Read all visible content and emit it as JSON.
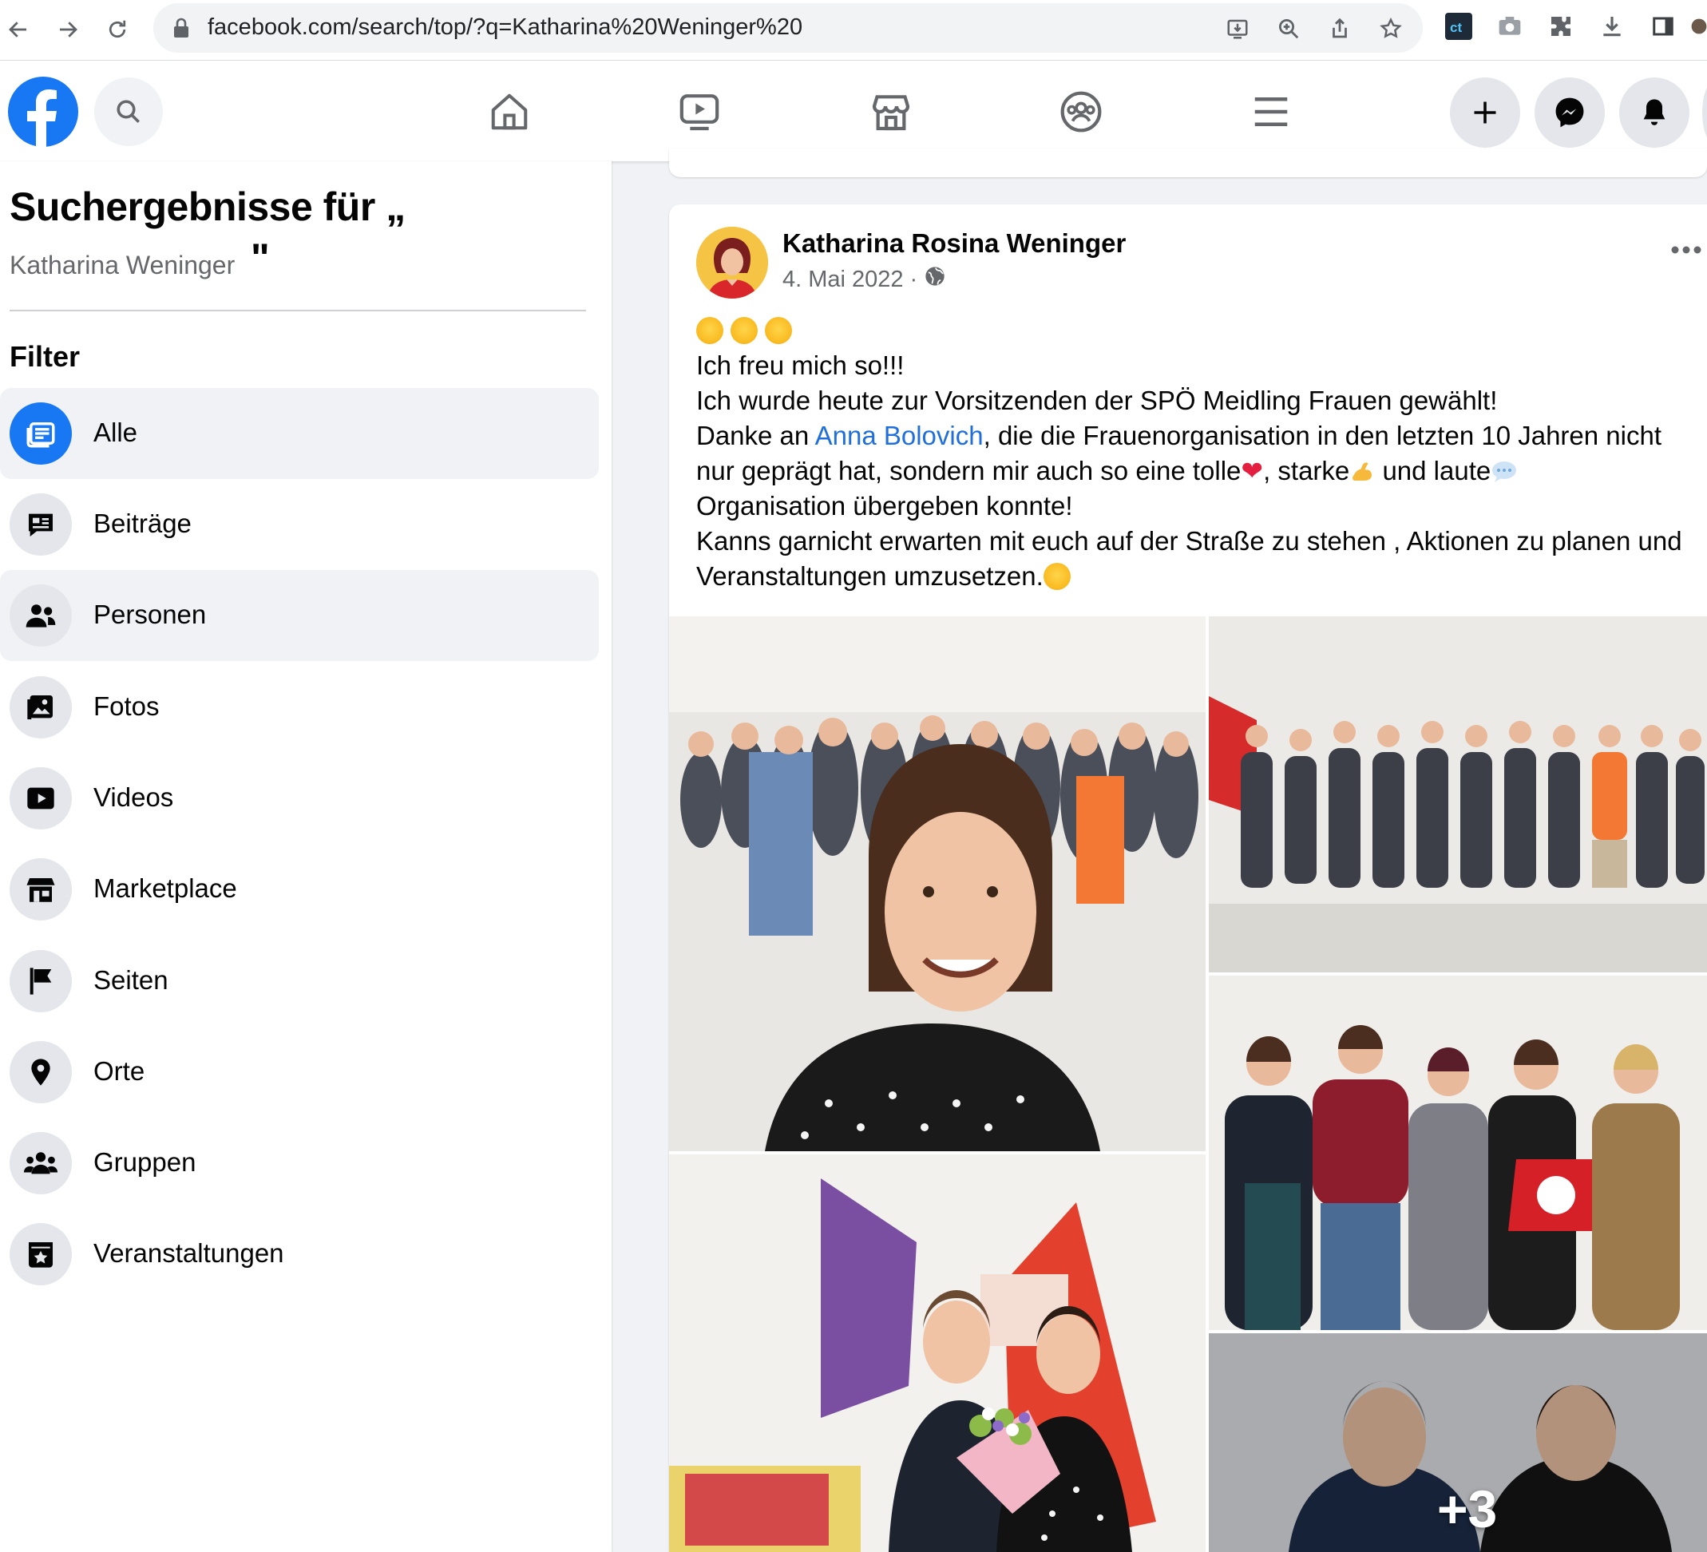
{
  "browser": {
    "url": "facebook.com/search/top/?q=Katharina%20Weninger%20"
  },
  "sidebar": {
    "title": "Suchergebnisse für „",
    "query": "Katharina Weninger",
    "close_quote": "\"",
    "filter_heading": "Filter",
    "items": [
      {
        "label": "Alle",
        "icon": "search-results-icon",
        "active": true
      },
      {
        "label": "Beiträge",
        "icon": "posts-icon"
      },
      {
        "label": "Personen",
        "icon": "people-icon",
        "hovered": true
      },
      {
        "label": "Fotos",
        "icon": "photos-icon"
      },
      {
        "label": "Videos",
        "icon": "video-play-icon"
      },
      {
        "label": "Marketplace",
        "icon": "marketplace-icon"
      },
      {
        "label": "Seiten",
        "icon": "flag-icon"
      },
      {
        "label": "Orte",
        "icon": "location-pin-icon"
      },
      {
        "label": "Gruppen",
        "icon": "groups-icon"
      },
      {
        "label": "Veranstaltungen",
        "icon": "calendar-star-icon"
      }
    ]
  },
  "post": {
    "author": "Katharina Rosina Weninger",
    "date": "4. Mai 2022",
    "separator": "·",
    "lines": {
      "l1": "Ich freu mich so!!!",
      "l2": "Ich wurde heute zur Vorsitzenden der SPÖ Meidling Frauen gewählt!",
      "l3a": "Danke an ",
      "l3link": "Anna Bolovich",
      "l3b": ", die die Frauenorganisation in den letzten 10 Jahren nicht",
      "l4a": "nur geprägt hat, sondern mir auch so eine tolle",
      "l4b": ", starke",
      "l4c": " und laute",
      "l5": "Organisation übergeben konnte!",
      "l6": "Kanns garnicht erwarten mit euch auf der Straße zu stehen , Aktionen zu planen und",
      "l7": "Veranstaltungen umzusetzen."
    },
    "more_photos": "+3"
  },
  "colors": {
    "fb_blue": "#1877f2",
    "link": "#216fdb",
    "bg": "#f0f2f5"
  }
}
